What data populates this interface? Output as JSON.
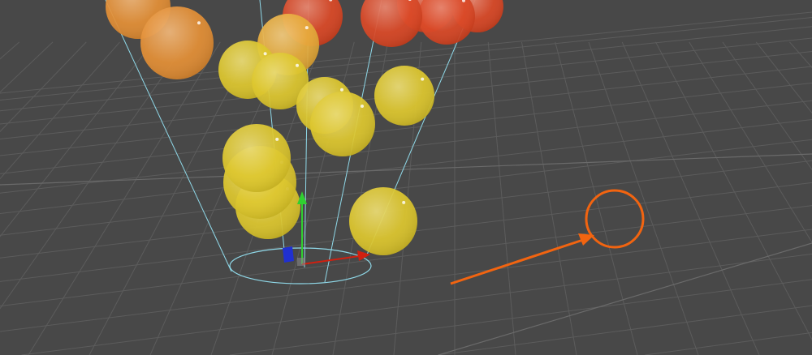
{
  "scene_view": {
    "background_color": "#484848",
    "grid_color": "#5c5c5c",
    "emitter_shape_color": "#8fd8e8",
    "gizmo": {
      "x_axis_color": "#d02010",
      "y_axis_color": "#30d030",
      "z_axis_color": "#2030d0"
    },
    "particle_colors": {
      "red": "#d8401c",
      "orange": "#e28a2c",
      "amber": "#e6a832",
      "yellow": "#dcc424"
    },
    "annotation_color": "#f26410"
  }
}
